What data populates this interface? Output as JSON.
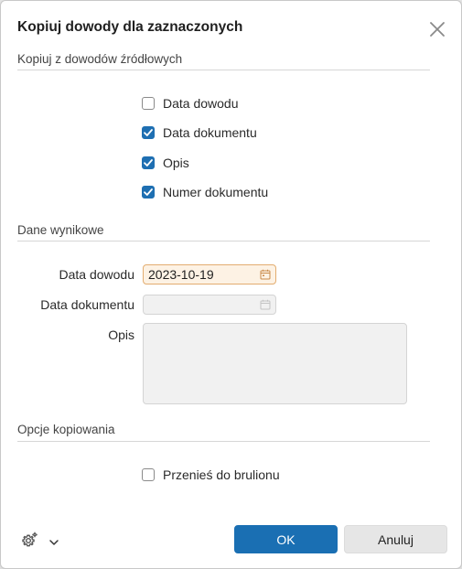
{
  "dialog": {
    "title": "Kopiuj dowody dla zaznaczonych"
  },
  "source_section": {
    "title": "Kopiuj z dowodów źródłowych",
    "options": [
      {
        "label": "Data dowodu",
        "checked": false
      },
      {
        "label": "Data dokumentu",
        "checked": true
      },
      {
        "label": "Opis",
        "checked": true
      },
      {
        "label": "Numer dokumentu",
        "checked": true
      }
    ]
  },
  "result_section": {
    "title": "Dane wynikowe",
    "data_dowodu_label": "Data dowodu",
    "data_dowodu_value": "2023-10-19",
    "data_dokumentu_label": "Data dokumentu",
    "data_dokumentu_value": "",
    "opis_label": "Opis",
    "opis_value": ""
  },
  "copy_options": {
    "title": "Opcje kopiowania",
    "move_to_draft": {
      "label": "Przenieś do brulionu",
      "checked": false
    }
  },
  "footer": {
    "settings_icon": "gear-icon",
    "ok_label": "OK",
    "cancel_label": "Anuluj"
  },
  "colors": {
    "primary": "#1a6fb3",
    "checkbox_checked": "#1e6fb2",
    "active_input_bg": "#fdf2e4",
    "active_input_border": "#e3ad70"
  }
}
